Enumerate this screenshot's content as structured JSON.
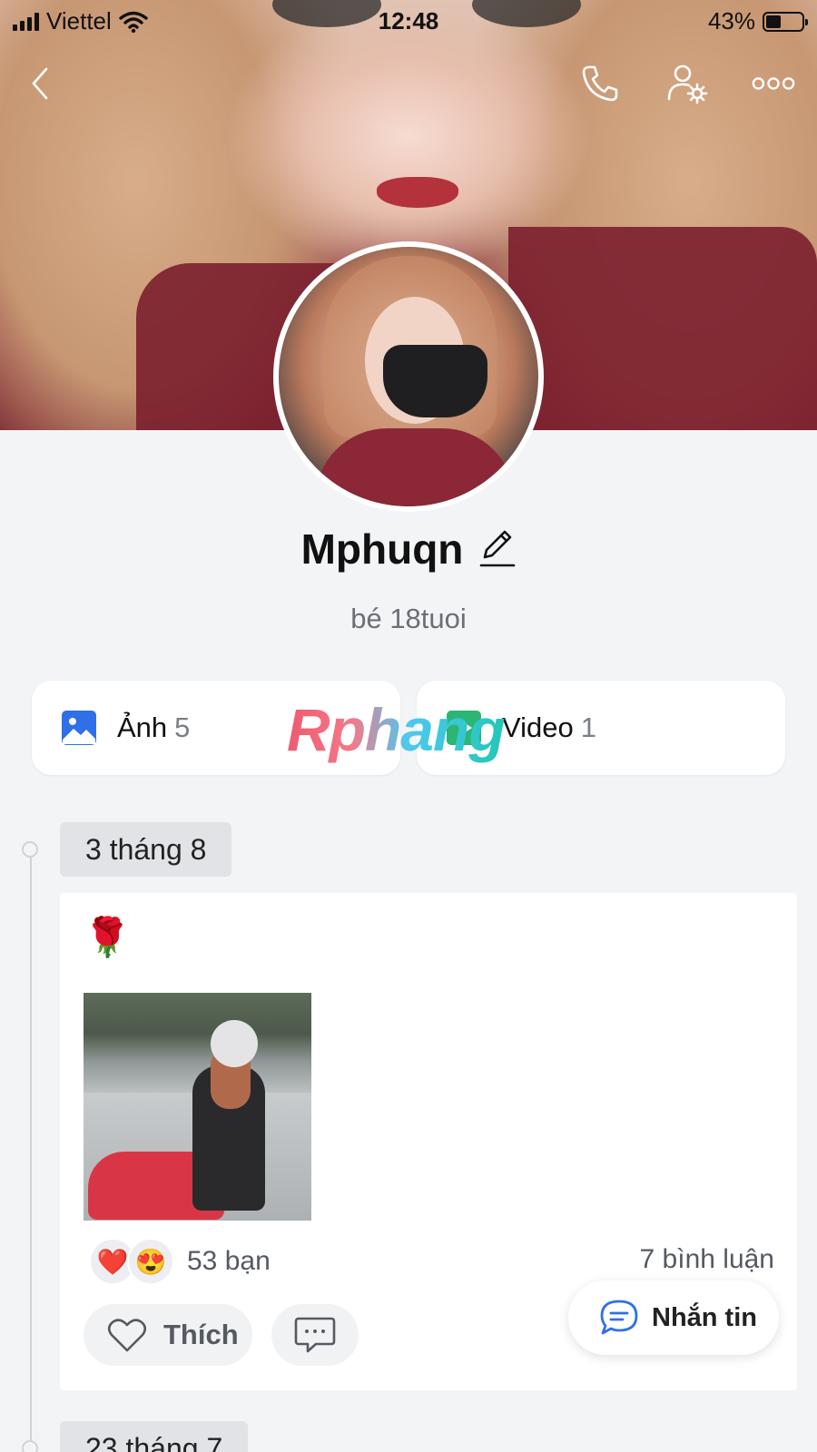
{
  "status_bar": {
    "carrier": "Viettel",
    "time": "12:48",
    "battery_percent": "43%",
    "battery_level": 0.43
  },
  "header": {
    "back_icon": "chevron-left-icon",
    "call_icon": "phone-icon",
    "settings_icon": "user-settings-icon",
    "more_icon": "more-dots-icon"
  },
  "profile": {
    "name": "Mphuqn",
    "bio": "bé 18tuoi"
  },
  "media": {
    "photos_label": "Ảnh",
    "photos_count": "5",
    "videos_label": "Video",
    "videos_count": "1"
  },
  "watermark": "Rphang",
  "timeline": {
    "entries": [
      {
        "date": "3 tháng 8",
        "post_text": "🌹",
        "reactions": [
          "❤️",
          "😍"
        ],
        "reaction_count": "53 bạn",
        "comment_count": "7 bình luận"
      },
      {
        "date": "23 tháng 7"
      }
    ]
  },
  "actions": {
    "like_label": "Thích",
    "message_label": "Nhắn tin"
  }
}
